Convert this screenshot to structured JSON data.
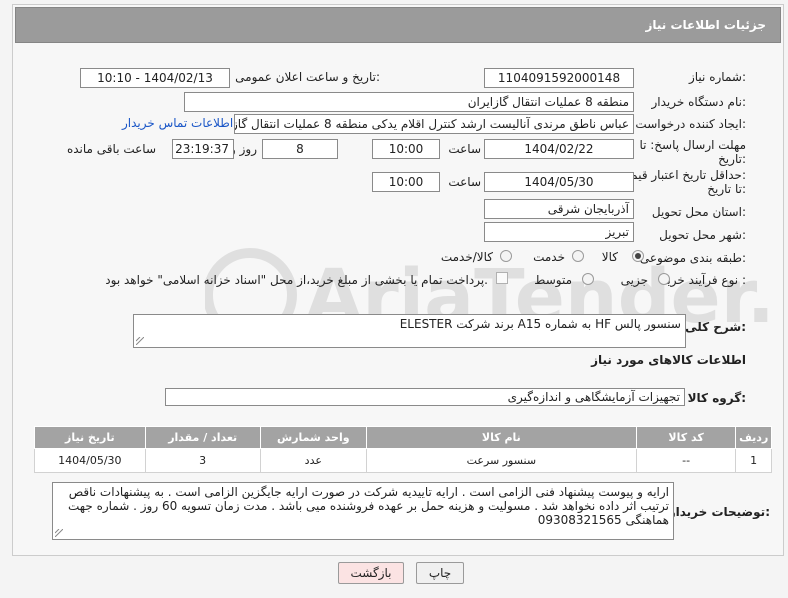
{
  "header": {
    "title": "جزئیات اطلاعات نیاز"
  },
  "fields": {
    "need_number_label": "شماره نیاز:",
    "need_number": "1104091592000148",
    "announce_label": "تاریخ و ساعت اعلان عمومی:",
    "announce_value": "1404/02/13 - 10:10",
    "buyer_org_label": "نام دستگاه خریدار:",
    "buyer_org": "منطقه 8 عملیات انتقال گازایران",
    "creator_label": "ایجاد کننده درخواست:",
    "creator": "عباس ناطق مرندی آنالیست ارشد کنترل اقلام یدکی منطقه 8 عملیات انتقال گاز",
    "contact_link": "اطلاعات تماس خریدار",
    "deadline_label_1": "مهلت ارسال پاسخ: تا",
    "deadline_label_2": "تاریخ:",
    "deadline_date": "1404/02/22",
    "time_label": "ساعت",
    "deadline_time": "10:00",
    "day_count": "8",
    "day_label": "روز و",
    "remaining_time": "23:19:37",
    "remaining_label": "ساعت باقی مانده",
    "validity_label_1": "حداقل تاریخ اعتبار قیمت:",
    "validity_label_2": "تا تاریخ:",
    "validity_date": "1404/05/30",
    "validity_time_label": "ساعت",
    "validity_time": "10:00",
    "province_label": "استان محل تحویل:",
    "province": "آذربایجان شرقی",
    "city_label": "شهر محل تحویل:",
    "city": "تبریز",
    "category_label": "طبقه بندی موضوعی:",
    "category_options": [
      "کالا",
      "خدمت",
      "کالا/خدمت"
    ],
    "category_selected": "کالا",
    "process_label": "نوع فرآیند خرید :",
    "process_options": [
      "جزیی",
      "متوسط"
    ],
    "process_note": "پرداخت تمام یا بخشی از مبلغ خرید،از محل \"اسناد خزانه اسلامی\" خواهد بود."
  },
  "description": {
    "label": "شرح کلی نیاز:",
    "value": "سنسور پالس HF به شماره A15 برند شرکت ELESTER"
  },
  "goods": {
    "section_title": "اطلاعات کالاهای مورد نیاز",
    "group_label": "گروه کالا:",
    "group_value": "تجهیزات آزمایشگاهی و اندازه‌گیری",
    "columns": [
      "ردیف",
      "کد کالا",
      "نام کالا",
      "واحد شمارش",
      "تعداد / مقدار",
      "تاریخ نیاز"
    ],
    "rows": [
      [
        "1",
        "--",
        "سنسور سرعت",
        "عدد",
        "3",
        "1404/05/30"
      ]
    ]
  },
  "buyer_notes": {
    "label": "توضیحات خریدار:",
    "value": "ارایه و پیوست پیشنهاد فنی الزامی است . ارایه تاییدیه شرکت در صورت ارایه جایگزین الزامی است . به پیشنهادات ناقص ترتیب اثر داده نخواهد شد . مسولیت و هزینه حمل بر عهده فروشنده میی باشد . مدت زمان تسویه 60 روز . شماره جهت هماهنگی 09308321565"
  },
  "buttons": {
    "print": "چاپ",
    "back": "بازگشت"
  },
  "watermark": {
    "text": "AriaTender.neT"
  },
  "colors": {
    "header_bg": "#9b9b9b",
    "link": "#1a56c7",
    "back_button_bg": "#fbe3e3"
  }
}
